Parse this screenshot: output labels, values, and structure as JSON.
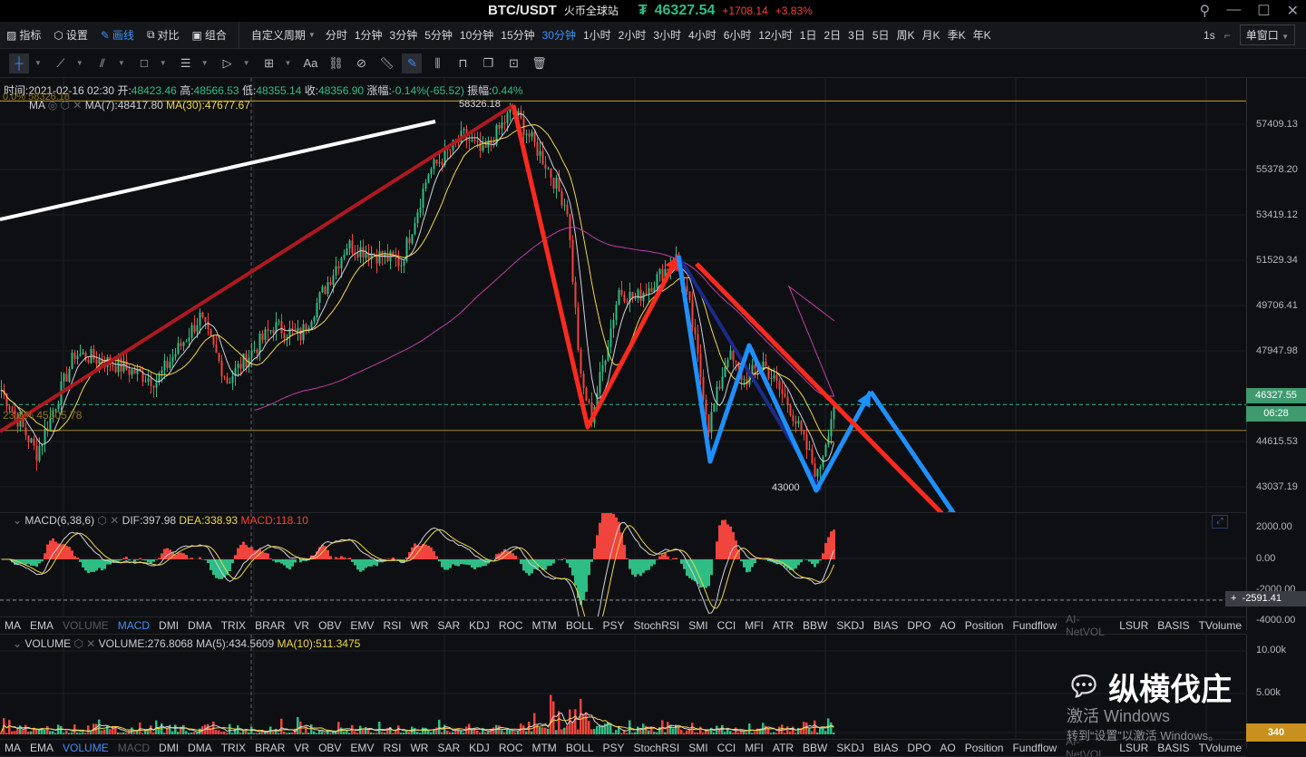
{
  "title": {
    "symbol": "BTC/USDT",
    "exchange": "火币全球站",
    "last_price": "46327.54",
    "change": "+1708.14",
    "change_pct": "+3.83%",
    "currency_icon": "₮"
  },
  "toolbar": {
    "indicator": "指标",
    "settings": "设置",
    "draw": "画线",
    "compare": "对比",
    "combine": "组合",
    "custom_period": "自定义周期",
    "periods": [
      "分时",
      "1分钟",
      "3分钟",
      "5分钟",
      "10分钟",
      "15分钟",
      "30分钟",
      "1小时",
      "2小时",
      "3小时",
      "4小时",
      "6小时",
      "12小时",
      "1日",
      "2日",
      "3日",
      "5日",
      "周K",
      "月K",
      "季K",
      "年K"
    ],
    "active_period": "30分钟",
    "refresh": "1s",
    "window_mode": "单窗口"
  },
  "drawing_tools": [
    "crosshair-icon",
    "trendline-icon",
    "parallel-channel-icon",
    "rectangle-icon",
    "fib-levels-icon",
    "pattern-icon",
    "measure-icon",
    "text-icon",
    "link-icon",
    "magnet-icon",
    "ruler-icon",
    "pen-icon",
    "fixed-icon",
    "lock-icon",
    "bookmark-icon",
    "hide-icon",
    "trash-icon"
  ],
  "text_tool": "Aa",
  "ohlc": {
    "time_label": "时间:",
    "time": "2021-02-16 02:30",
    "open_label": "开:",
    "open": "48423.46",
    "high_label": "高:",
    "high": "48566.53",
    "low_label": "低:",
    "low": "48355.14",
    "close_label": "收:",
    "close": "48356.90",
    "change_label": "涨幅:",
    "change": "-0.14%(-65.52)",
    "amp_label": "振幅:",
    "amp": "0.44%"
  },
  "ma": {
    "name": "MA",
    "ma7": "MA(7):48417.80",
    "ma30": "MA(30):47677.67"
  },
  "annotations": {
    "fib0": "0.0% 58326.18",
    "fib236": "23.6% 45305.78",
    "high": "58326.18",
    "low": "43000"
  },
  "price_axis": {
    "ticks": [
      "57409.13",
      "55378.20",
      "53419.12",
      "51529.34",
      "49706.41",
      "47947.98",
      "44615.53",
      "43037.19"
    ],
    "current": "46327.55",
    "countdown": "06:28"
  },
  "macd": {
    "name": "MACD(6,38,6)",
    "dif": "DIF:397.98",
    "dea": "DEA:338.93",
    "macd": "MACD:118.10",
    "ticks": [
      "2000.00",
      "0.00",
      "-2000.00",
      "-4000.00"
    ],
    "cursor": "-2591.41"
  },
  "indicator_tabs": [
    "MA",
    "EMA",
    "VOLUME",
    "MACD",
    "DMI",
    "DMA",
    "TRIX",
    "BRAR",
    "VR",
    "OBV",
    "EMV",
    "RSI",
    "WR",
    "SAR",
    "KDJ",
    "ROC",
    "MTM",
    "BOLL",
    "PSY",
    "StochRSI",
    "SMI",
    "CCI",
    "MFI",
    "ATR",
    "BBW",
    "SKDJ",
    "BIAS",
    "DPO",
    "AO",
    "Position",
    "Fundflow",
    "AI-NetVOL",
    "LSUR",
    "BASIS",
    "TVolume"
  ],
  "volume": {
    "name": "VOLUME",
    "vol": "VOLUME:276.8068",
    "ma5": "MA(5):434.5609",
    "ma10": "MA(10):511.3475",
    "ticks": [
      "10.00k",
      "5.00k"
    ],
    "current": "340"
  },
  "watermark": {
    "brand": "纵横伐庄",
    "activate1": "激活 Windows",
    "activate2": "转到“设置”以激活 Windows。"
  },
  "colors": {
    "up": "#2ebd85",
    "down": "#f0443c",
    "accent": "#3e8ef7",
    "ma30": "#f0d64a",
    "fib": "#c8a11e"
  },
  "chart_data": {
    "type": "candlestick",
    "interval": "30分钟",
    "price_range": [
      42500,
      58700
    ],
    "anchors": [
      [
        0,
        46908
      ],
      [
        13,
        44399
      ],
      [
        27,
        48341
      ],
      [
        40,
        47983
      ],
      [
        57,
        47266
      ],
      [
        73,
        49775
      ],
      [
        83,
        47266
      ],
      [
        100,
        49417
      ],
      [
        110,
        49058
      ],
      [
        127,
        52642
      ],
      [
        147,
        51926
      ],
      [
        157,
        55509
      ],
      [
        170,
        56943
      ],
      [
        177,
        56226
      ],
      [
        188,
        58018
      ],
      [
        200,
        55868
      ],
      [
        208,
        54076
      ],
      [
        213,
        47266
      ],
      [
        217,
        45833
      ],
      [
        227,
        50850
      ],
      [
        233,
        50492
      ],
      [
        240,
        51209
      ],
      [
        248,
        52105
      ],
      [
        253,
        50133
      ],
      [
        260,
        45474
      ],
      [
        267,
        48341
      ],
      [
        273,
        47266
      ],
      [
        280,
        47983
      ],
      [
        290,
        46191
      ],
      [
        300,
        43503
      ],
      [
        306,
        46327
      ]
    ]
  }
}
